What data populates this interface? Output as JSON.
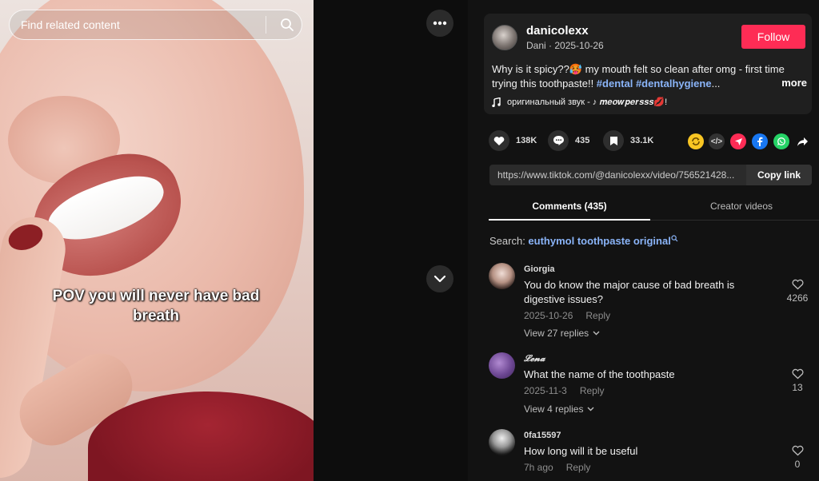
{
  "search": {
    "placeholder": "Find related content"
  },
  "video": {
    "caption": "POV you will never have bad breath"
  },
  "author": {
    "username": "danicolexx",
    "subline": "Dani · 2025-10-26",
    "follow_label": "Follow"
  },
  "description": {
    "text": "Why is it spicy??🥵 my mouth felt so clean after omg - first time trying this toothpaste!! ",
    "tag1": "#dental",
    "tag2": "#dentalhygiene",
    "ellipsis": "...",
    "more_label": "more"
  },
  "music": {
    "title": "оригинальный звук - ♪ 𝒎𝒆𝒐𝒘𝒑𝒆𝒓𝒔𝒔𝒔💋!"
  },
  "stats": {
    "likes": "138K",
    "comments": "435",
    "saves": "33.1K"
  },
  "share": {
    "link": "https://www.tiktok.com/@danicolexx/video/756521428...",
    "copy_label": "Copy link",
    "embed_label": "</>"
  },
  "tabs": {
    "comments": "Comments (435)",
    "creator": "Creator videos"
  },
  "search_suggestion": {
    "prefix": "Search: ",
    "keyword": "euthymol toothpaste original"
  },
  "comments": [
    {
      "user": "Giorgia",
      "text": "You do know the major cause of bad breath is digestive issues?",
      "date": "2025-10-26",
      "reply_label": "Reply",
      "replies": "View 27 replies",
      "likes": "4266"
    },
    {
      "user": "𝓛𝓮𝓷𝓪",
      "text": "What the name of the toothpaste",
      "date": "2025-11-3",
      "reply_label": "Reply",
      "replies": "View 4 replies",
      "likes": "13"
    },
    {
      "user": "0fa15597",
      "text": "How long will it be useful",
      "date": "7h ago",
      "reply_label": "Reply",
      "likes": "0"
    }
  ],
  "colors": {
    "accent": "#fe2c55",
    "link": "#8ab4f8",
    "panel": "#121212",
    "card": "#1f1f1f"
  }
}
